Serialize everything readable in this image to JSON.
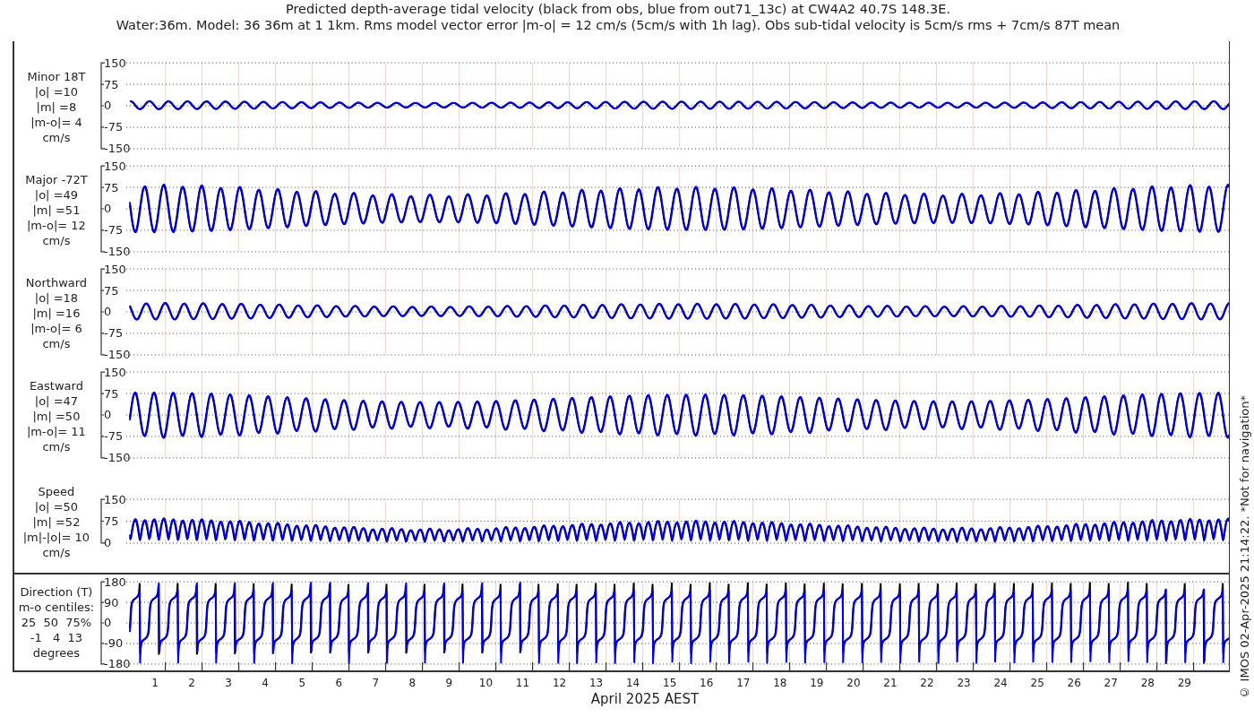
{
  "title": {
    "lines": [
      "Predicted depth-average tidal velocity (black from obs, blue from out71_13c) at CW4A2 40.7S 148.3E.",
      "Water:36m. Model: 36 36m at 1 1km. Rms model vector error |m-o| = 12 cm/s (5cm/s with 1h lag). Obs sub-tidal velocity is 5cm/s rms + 7cm/s 87T mean"
    ]
  },
  "panels": [
    {
      "kind": "minor",
      "label_lines": [
        "Minor 18T",
        "|o| =10",
        "|m| =8",
        "|m-o|= 4",
        "cm/s"
      ],
      "yticks": [
        "150",
        "75",
        "0",
        "-75",
        "-150"
      ]
    },
    {
      "kind": "major",
      "label_lines": [
        "Major -72T",
        "|o| =49",
        "|m| =51",
        "|m-o|= 12",
        "cm/s"
      ],
      "yticks": [
        "150",
        "75",
        "0",
        "-75",
        "-150"
      ]
    },
    {
      "kind": "northward",
      "label_lines": [
        "Northward",
        "|o| =18",
        "|m| =16",
        "|m-o|= 6",
        "cm/s"
      ],
      "yticks": [
        "150",
        "75",
        "0",
        "-75",
        "-150"
      ]
    },
    {
      "kind": "eastward",
      "label_lines": [
        "Eastward",
        "|o| =47",
        "|m| =50",
        "|m-o|= 11",
        "cm/s"
      ],
      "yticks": [
        "150",
        "75",
        "0",
        "-75",
        "-150"
      ]
    },
    {
      "kind": "speed",
      "label_lines": [
        "Speed",
        "|o| =50",
        "|m| =52",
        "|m|-|o|= 10",
        "cm/s"
      ],
      "yticks": [
        "150",
        "75",
        "0"
      ]
    },
    {
      "kind": "direction",
      "label_lines": [
        "Direction (T)",
        "m-o centiles:",
        "25  50  75%",
        "-1   4  13",
        "degrees"
      ],
      "yticks": [
        "180",
        "90",
        "0",
        "-90",
        "-180"
      ]
    }
  ],
  "x_axis": {
    "days": [
      "1",
      "2",
      "3",
      "4",
      "5",
      "6",
      "7",
      "8",
      "9",
      "10",
      "11",
      "12",
      "13",
      "14",
      "15",
      "16",
      "17",
      "18",
      "19",
      "20",
      "21",
      "22",
      "23",
      "24",
      "25",
      "26",
      "27",
      "28",
      "29"
    ],
    "label": "April 2025 AEST"
  },
  "footer_note": "© IMOS 02-Apr-2025 21:14:22. *Not for navigation*"
}
